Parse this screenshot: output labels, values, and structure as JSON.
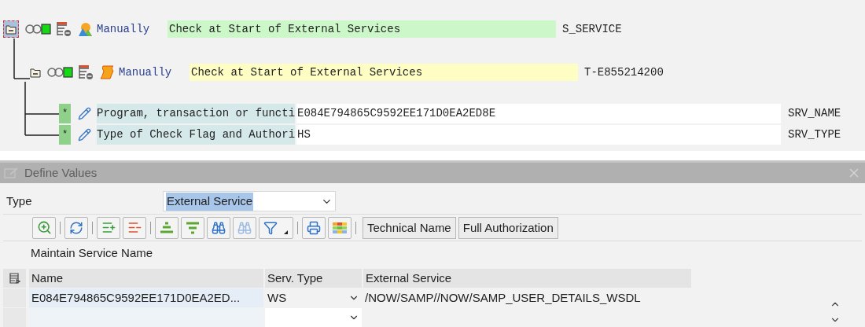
{
  "tree": {
    "root": {
      "expanded": true,
      "selected": true,
      "kind": "object",
      "mode": "Manually",
      "description": "Check at Start of External Services",
      "color": "#ccf7c8",
      "technical": "S_SERVICE",
      "children": [
        {
          "expanded": true,
          "selected": false,
          "kind": "authorization",
          "mode": "Manually",
          "description": "Check at Start of External Services",
          "color": "#fdfdc4",
          "technical": "T-E855214200",
          "fields": [
            {
              "marker": "*",
              "label": "Program, transaction or functi",
              "value": "E084E794865C9592EE171D0EA2ED8E",
              "technical": "SRV_NAME"
            },
            {
              "marker": "*",
              "label": "Type of Check Flag and Authori",
              "value": "HS",
              "technical": "SRV_TYPE"
            }
          ]
        }
      ]
    }
  },
  "dialog": {
    "title": "Define Values",
    "type_label": "Type",
    "type_value": "External Service",
    "toolbar_buttons": [
      "Technical Name",
      "Full Authorization"
    ],
    "table": {
      "title": "Maintain Service Name",
      "columns": [
        "Name",
        "Serv. Type",
        "External Service"
      ],
      "rows": [
        {
          "name": "E084E794865C9592EE171D0EA2ED...",
          "serv_type": "WS",
          "external_service": "/NOW/SAMP//NOW/SAMP_USER_DETAILS_WSDL"
        }
      ]
    }
  }
}
